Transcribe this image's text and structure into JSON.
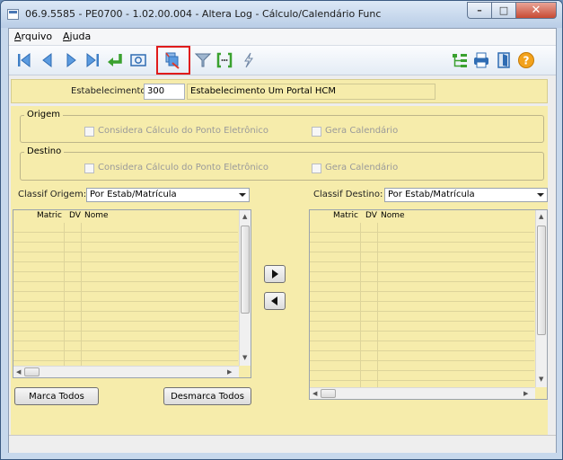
{
  "window": {
    "title": "06.9.5585 - PE0700 - 1.02.00.004 - Altera Log - Cálculo/Calendário Func",
    "minimize_glyph": "–",
    "maximize_glyph": "□",
    "close_glyph": "✕"
  },
  "menu": {
    "file_prefix": "A",
    "file_rest": "rquivo",
    "help_prefix": "A",
    "help_rest": "juda"
  },
  "toolbar": {
    "icons": [
      "first-icon",
      "prev-icon",
      "next-icon",
      "last-icon",
      "go-to-icon",
      "search-icon",
      "list-selection-icon",
      "filter-icon",
      "bracket-icon",
      "lightning-icon",
      "tree-icon",
      "print-icon",
      "exit-icon",
      "help-icon"
    ],
    "highlighted": "list-selection-icon"
  },
  "form": {
    "estabelecimento_label": "Estabelecimento:",
    "estabelecimento_code": "300",
    "estabelecimento_name": "Estabelecimento Um Portal HCM",
    "origem": {
      "title": "Origem",
      "calc_label": "Considera Cálculo do Ponto Eletrônico",
      "cal_label": "Gera Calendário"
    },
    "destino": {
      "title": "Destino",
      "calc_label": "Considera Cálculo do Ponto Eletrônico",
      "cal_label": "Gera Calendário"
    },
    "classif_origem_label": "Classif Origem:",
    "classif_origem_value": "Por Estab/Matrícula",
    "classif_destino_label": "Classif Destino:",
    "classif_destino_value": "Por Estab/Matrícula"
  },
  "grid_left": {
    "columns": [
      "Matric",
      "DV",
      "Nome"
    ],
    "rows": []
  },
  "grid_right": {
    "columns": [
      "Matric",
      "DV",
      "Nome"
    ],
    "rows": []
  },
  "buttons": {
    "marca_todos": "Marca Todos",
    "desmarca_todos": "Desmarca Todos"
  },
  "colors": {
    "form_background": "#f6ecab",
    "highlight": "#e01b1b"
  }
}
